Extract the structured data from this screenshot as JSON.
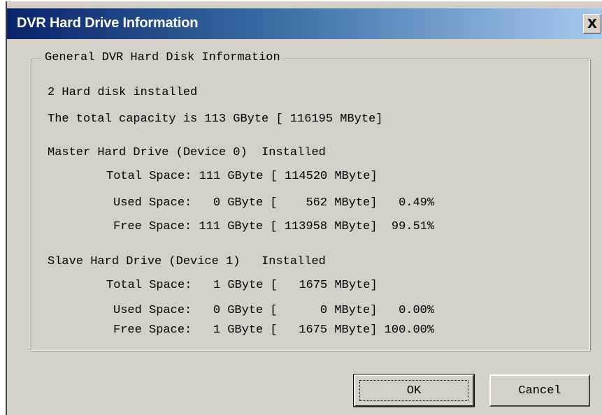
{
  "window": {
    "title": "DVR Hard Drive Information",
    "close_glyph": "X"
  },
  "group": {
    "title": "General DVR Hard Disk Information"
  },
  "summary": {
    "installed_text": "2 Hard disk installed",
    "capacity_text": "The total capacity is 113 GByte [ 116195 MByte]"
  },
  "drives": [
    {
      "header": "Master Hard Drive (Device 0)  Installed",
      "total": "Total Space: 111 GByte [ 114520 MByte]",
      "used": "Used Space:   0 GByte [    562 MByte]   0.49%",
      "free": "Free Space: 111 GByte [ 113958 MByte]  99.51%"
    },
    {
      "header": "Slave Hard Drive (Device 1)   Installed",
      "total": "Total Space:   1 GByte [   1675 MByte]",
      "used": "Used Space:   0 GByte [      0 MByte]   0.00%",
      "free": "Free Space:   1 GByte [   1675 MByte] 100.00%"
    }
  ],
  "buttons": {
    "ok_label": "OK",
    "cancel_label": "Cancel"
  },
  "colors": {
    "titlebar_start": "#0a246a",
    "titlebar_end": "#a6caf0",
    "face": "#d4d0c8"
  }
}
